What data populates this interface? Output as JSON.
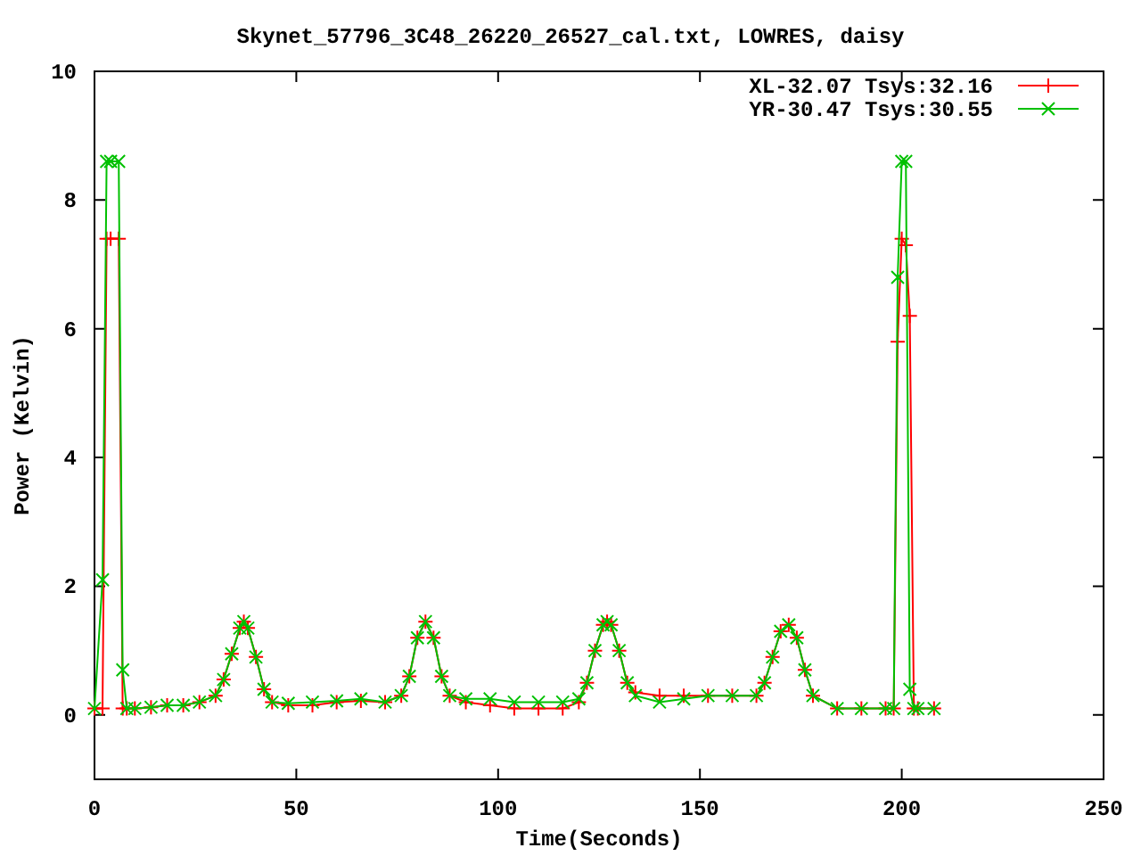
{
  "chart": {
    "chart_data": {
      "type": "line",
      "title": "Skynet_57796_3C48_26220_26527_cal.txt, LOWRES, daisy",
      "xlabel": "Time(Seconds)",
      "ylabel": "Power (Kelvin)",
      "x": [
        0,
        2,
        3,
        4,
        6,
        7,
        8,
        10,
        14,
        18,
        22,
        26,
        30,
        32,
        34,
        36,
        37,
        38,
        40,
        42,
        44,
        48,
        54,
        60,
        66,
        72,
        76,
        78,
        80,
        82,
        84,
        86,
        88,
        92,
        98,
        104,
        110,
        116,
        120,
        122,
        124,
        126,
        127,
        128,
        130,
        132,
        134,
        140,
        146,
        152,
        158,
        164,
        166,
        168,
        170,
        172,
        174,
        176,
        178,
        184,
        190,
        196,
        198,
        199,
        200,
        201,
        202,
        203,
        204,
        208
      ],
      "series": [
        {
          "name": "XL-32.07 Tsys:32.16",
          "color": "#ff0000",
          "marker": "plus",
          "values": [
            0.1,
            0.1,
            7.4,
            7.4,
            7.4,
            0.1,
            0.1,
            0.1,
            0.12,
            0.15,
            0.15,
            0.2,
            0.3,
            0.55,
            0.95,
            1.35,
            1.45,
            1.35,
            0.9,
            0.4,
            0.2,
            0.15,
            0.15,
            0.2,
            0.22,
            0.2,
            0.3,
            0.6,
            1.2,
            1.45,
            1.2,
            0.6,
            0.3,
            0.2,
            0.15,
            0.1,
            0.1,
            0.1,
            0.2,
            0.5,
            1.0,
            1.4,
            1.45,
            1.4,
            1.0,
            0.5,
            0.35,
            0.3,
            0.3,
            0.3,
            0.3,
            0.3,
            0.5,
            0.9,
            1.3,
            1.4,
            1.2,
            0.7,
            0.3,
            0.1,
            0.1,
            0.1,
            0.1,
            5.8,
            7.4,
            7.3,
            6.2,
            0.1,
            0.1,
            0.1
          ]
        },
        {
          "name": "YR-30.47 Tsys:30.55",
          "color": "#00c000",
          "marker": "cross",
          "values": [
            0.1,
            2.1,
            8.6,
            8.6,
            8.6,
            0.7,
            0.1,
            0.1,
            0.12,
            0.15,
            0.15,
            0.2,
            0.3,
            0.55,
            0.95,
            1.35,
            1.45,
            1.35,
            0.9,
            0.4,
            0.2,
            0.18,
            0.2,
            0.22,
            0.25,
            0.2,
            0.3,
            0.6,
            1.2,
            1.45,
            1.2,
            0.6,
            0.3,
            0.25,
            0.25,
            0.2,
            0.2,
            0.2,
            0.25,
            0.5,
            1.0,
            1.4,
            1.45,
            1.4,
            1.0,
            0.5,
            0.3,
            0.2,
            0.25,
            0.3,
            0.3,
            0.3,
            0.5,
            0.9,
            1.3,
            1.4,
            1.2,
            0.7,
            0.3,
            0.1,
            0.1,
            0.1,
            0.1,
            6.8,
            8.6,
            8.6,
            0.4,
            0.1,
            0.1,
            0.1
          ]
        }
      ],
      "legend": "top-right",
      "xlim": [
        0,
        250
      ],
      "ylim": [
        -1,
        10
      ],
      "xticks": [
        0,
        50,
        100,
        150,
        200,
        250
      ],
      "yticks": [
        0,
        2,
        4,
        6,
        8,
        10
      ]
    }
  }
}
